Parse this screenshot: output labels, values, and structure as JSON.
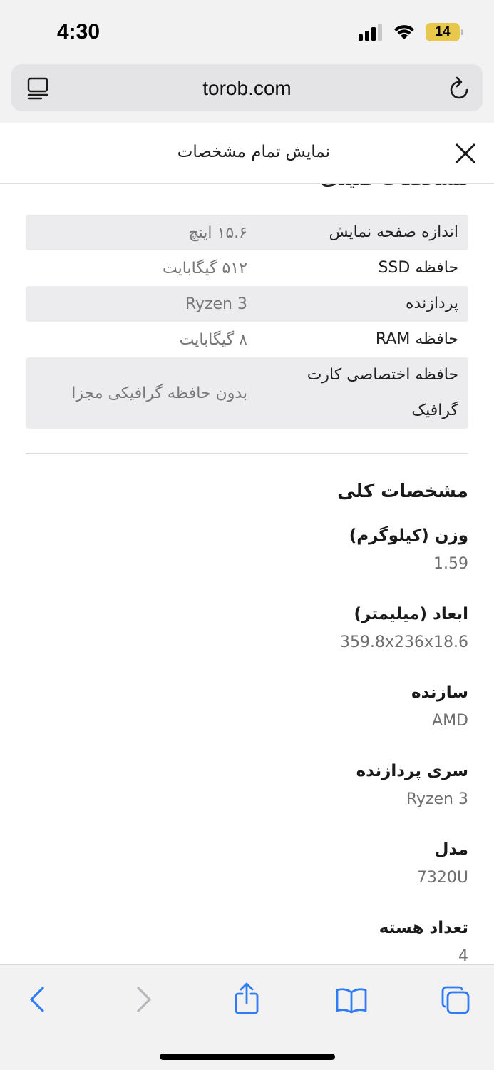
{
  "status_bar": {
    "time": "4:30",
    "battery": "14"
  },
  "browser": {
    "url": "torob.com"
  },
  "panel": {
    "title": "نمایش تمام مشخصات",
    "cut_heading": "مشخصات کلیدی"
  },
  "key_specs": [
    {
      "label": "اندازه صفحه نمایش",
      "value": "۱۵.۶ اینچ"
    },
    {
      "label": "حافظه SSD",
      "value": "۵۱۲ گیگابایت"
    },
    {
      "label": "پردازنده",
      "value": "Ryzen 3"
    },
    {
      "label": "حافظه RAM",
      "value": "۸ گیگابایت"
    },
    {
      "label": "حافظه اختصاصی کارت گرافیک",
      "value": "بدون حافظه گرافیکی مجزا"
    }
  ],
  "general": {
    "title": "مشخصات کلی",
    "items": [
      {
        "label": "وزن (کیلوگرم)",
        "value": "1.59"
      },
      {
        "label": "ابعاد (میلیمتر)",
        "value": "359.8x236x18.6"
      },
      {
        "label": "سازنده",
        "value": "AMD"
      },
      {
        "label": "سری پردازنده",
        "value": "Ryzen 3"
      },
      {
        "label": "مدل",
        "value": "7320U"
      },
      {
        "label": "تعداد هسته",
        "value": "4"
      }
    ]
  },
  "colors": {
    "accent": "#2f7cf6",
    "disabled": "#b8b8bc"
  }
}
